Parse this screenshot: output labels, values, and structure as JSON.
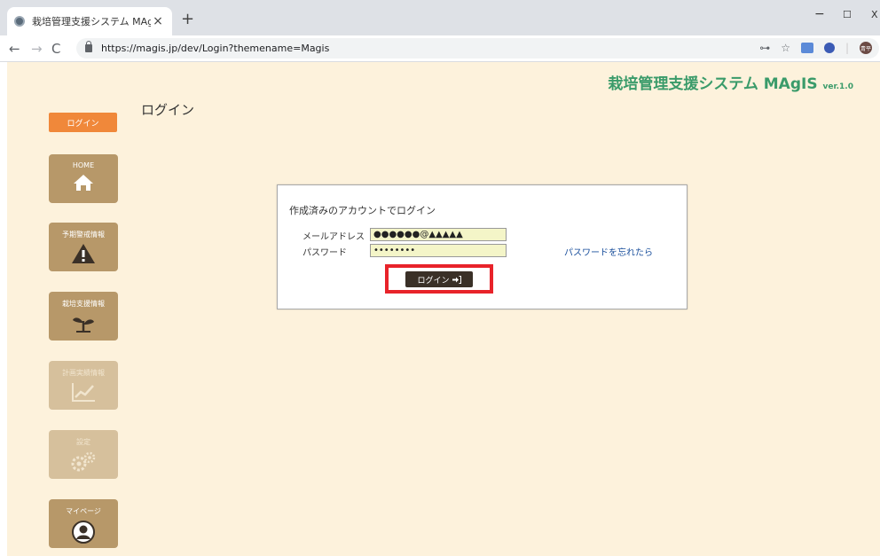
{
  "browser": {
    "tab_title": "栽培管理支援システム MAgIS",
    "tab_close": "×",
    "new_tab": "+",
    "url": "https://magis.jp/dev/Login?themename=Magis",
    "minimize": "−",
    "maximize": "☐",
    "close": "X",
    "profile_text": "青平"
  },
  "header": {
    "brand_title": "栽培管理支援システム MAgIS",
    "brand_version": "ver.1.0"
  },
  "sidebar": {
    "login_label": "ログイン",
    "items": [
      {
        "label": "HOME",
        "icon": "home-icon"
      },
      {
        "label": "予期警戒情報",
        "icon": "warning-icon"
      },
      {
        "label": "栽培支援情報",
        "icon": "plant-icon"
      },
      {
        "label": "計画実績情報",
        "icon": "chart-icon"
      },
      {
        "label": "設定",
        "icon": "gear-icon"
      },
      {
        "label": "マイページ",
        "icon": "user-icon"
      }
    ]
  },
  "main": {
    "heading": "ログイン",
    "box_title": "作成済みのアカウントでログイン",
    "email_label": "メールアドレス",
    "email_value": "●●●●●●@▲▲▲▲▲",
    "password_label": "パスワード",
    "password_value": "••••••••",
    "forgot_link": "パスワードを忘れたら",
    "login_button": "ログイン",
    "highlight_color": "#e8232a"
  }
}
